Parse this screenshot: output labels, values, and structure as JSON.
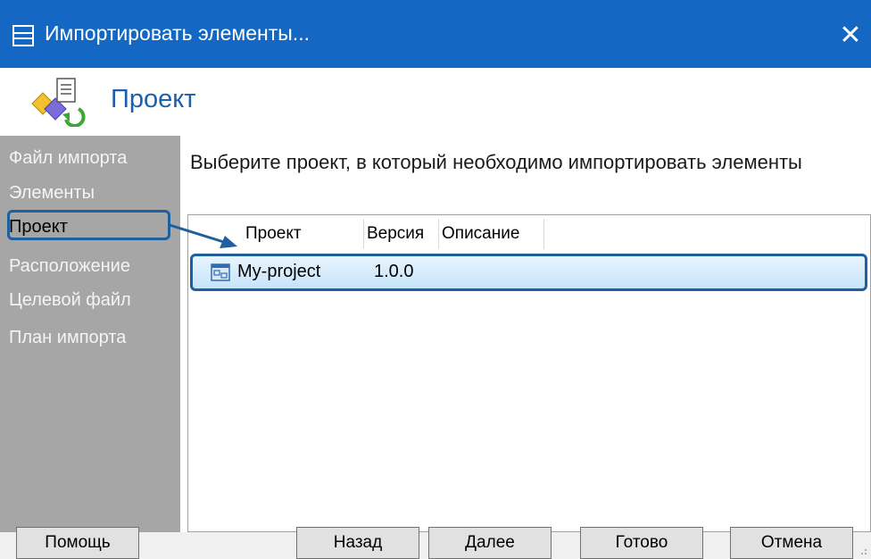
{
  "window": {
    "title": "Импортировать элементы..."
  },
  "header": {
    "title": "Проект"
  },
  "sidebar": {
    "steps": [
      {
        "label": "Файл импорта"
      },
      {
        "label": "Элементы"
      },
      {
        "label": "Проект"
      },
      {
        "label": "Расположение"
      },
      {
        "label": "Целевой файл"
      },
      {
        "label": "План импорта"
      }
    ],
    "active_index": 2
  },
  "main": {
    "prompt": "Выберите проект, в который необходимо импортировать элементы",
    "table": {
      "columns": [
        "Проект",
        "Версия",
        "Описание"
      ],
      "rows": [
        {
          "project": "My-project",
          "version": "1.0.0",
          "description": "",
          "selected": true
        }
      ]
    }
  },
  "buttons": {
    "help": "Помощь",
    "back": "Назад",
    "next": "Далее",
    "finish": "Готово",
    "cancel": "Отмена"
  },
  "colors": {
    "titlebar": "#1468c4",
    "accent_title": "#1c5fb0",
    "sidebar_bg": "#a6a6a6",
    "highlight_border": "#1f5f9e",
    "row_selected": "#c6e4fb"
  },
  "icons": {
    "app": "window-icon",
    "close": "close-icon",
    "wizard": "import-wizard-icon",
    "row": "project-icon"
  }
}
